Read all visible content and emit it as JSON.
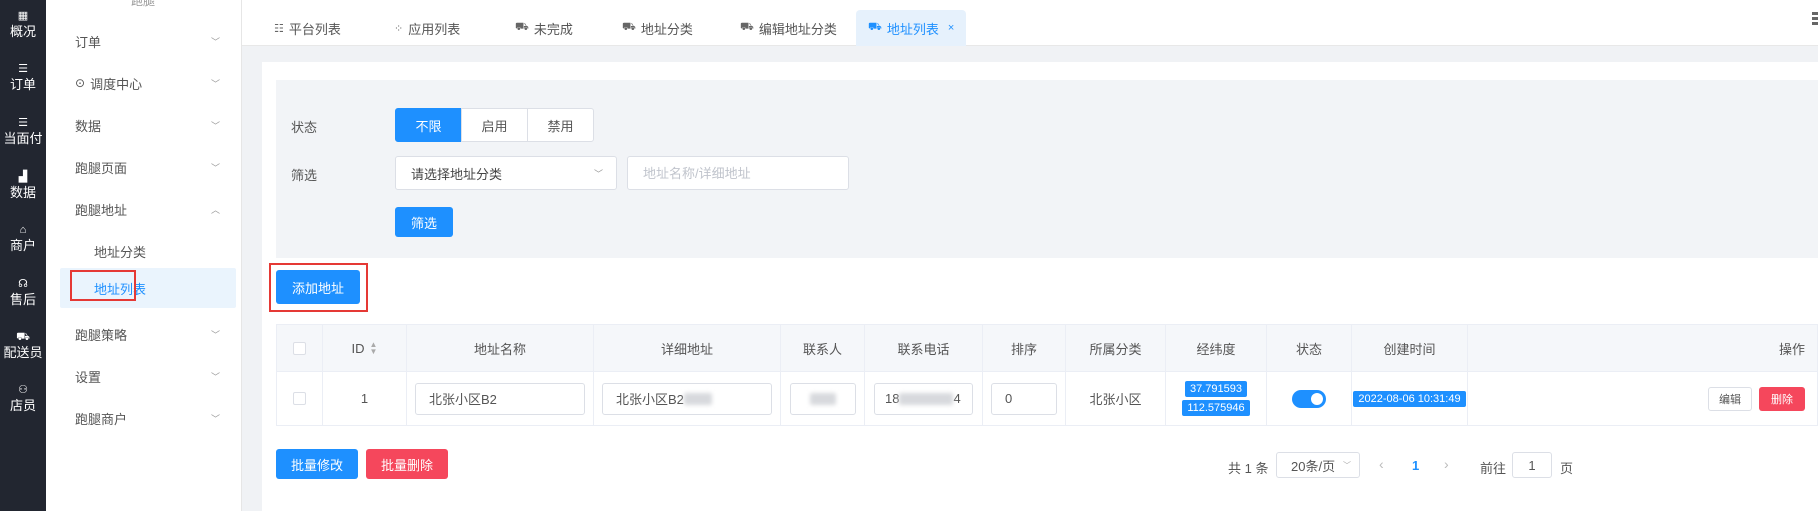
{
  "rail": {
    "items": [
      {
        "icon": "dashboard-icon",
        "glyph": "▦",
        "label": "概况"
      },
      {
        "icon": "list-icon",
        "glyph": "☰",
        "label": "订单"
      },
      {
        "icon": "list-icon",
        "glyph": "☰",
        "label": "当面付"
      },
      {
        "icon": "bar-chart-icon",
        "glyph": "▟",
        "label": "数据"
      },
      {
        "icon": "store-icon",
        "glyph": "⌂",
        "label": "商户"
      },
      {
        "icon": "headset-icon",
        "glyph": "☊",
        "label": "售后"
      },
      {
        "icon": "scooter-icon",
        "glyph": "⛟",
        "label": "配送员"
      },
      {
        "icon": "user-icon",
        "glyph": "⚇",
        "label": "店员"
      }
    ]
  },
  "submenu": {
    "top_partial": "跑腿",
    "items": [
      {
        "label": "订单",
        "expanded": false
      },
      {
        "label": "调度中心",
        "expanded": false,
        "icon": "location-icon"
      },
      {
        "label": "数据",
        "expanded": false
      },
      {
        "label": "跑腿页面",
        "expanded": false
      },
      {
        "label": "跑腿地址",
        "expanded": true
      },
      {
        "label": "跑腿策略",
        "expanded": false
      },
      {
        "label": "设置",
        "expanded": false
      },
      {
        "label": "跑腿商户",
        "expanded": false
      }
    ],
    "sub_items": [
      {
        "label": "地址分类"
      },
      {
        "label": "地址列表"
      }
    ]
  },
  "tabs": [
    {
      "label": "平台列表",
      "icon": "grid-list-icon"
    },
    {
      "label": "应用列表",
      "icon": "apps-icon"
    },
    {
      "label": "未完成",
      "icon": "scooter-icon"
    },
    {
      "label": "地址分类",
      "icon": "scooter-icon"
    },
    {
      "label": "编辑地址分类",
      "icon": "scooter-icon"
    },
    {
      "label": "地址列表",
      "icon": "scooter-icon",
      "active": true
    }
  ],
  "filter": {
    "status_label": "状态",
    "status_options": [
      "不限",
      "启用",
      "禁用"
    ],
    "status_selected": "不限",
    "filter_label": "筛选",
    "category_select": "请选择地址分类",
    "search_placeholder": "地址名称/详细地址",
    "filter_button": "筛选"
  },
  "actions": {
    "add_button": "添加地址",
    "batch_edit": "批量修改",
    "batch_delete": "批量删除"
  },
  "table": {
    "headers": [
      "ID",
      "地址名称",
      "详细地址",
      "联系人",
      "联系电话",
      "排序",
      "所属分类",
      "经纬度",
      "状态",
      "创建时间",
      "操作"
    ],
    "rows": [
      {
        "id": "1",
        "name": "北张小区B2",
        "detail": "北张小区B2",
        "phone_prefix": "18",
        "phone_suffix": "4",
        "sort": "0",
        "category": "北张小区",
        "lat": "37.791593",
        "lng": "112.575946",
        "status_on": true,
        "created": "2022-08-06 10:31:49",
        "edit": "编辑",
        "delete": "删除"
      }
    ]
  },
  "pagination": {
    "total": "共 1 条",
    "page_size": "20条/页",
    "current": "1",
    "goto_label": "前往",
    "goto_value": "1",
    "page_unit": "页"
  },
  "colors": {
    "primary": "#1e90ff",
    "danger": "#f5475c",
    "rail": "#222630",
    "highlight": "#e53935"
  }
}
